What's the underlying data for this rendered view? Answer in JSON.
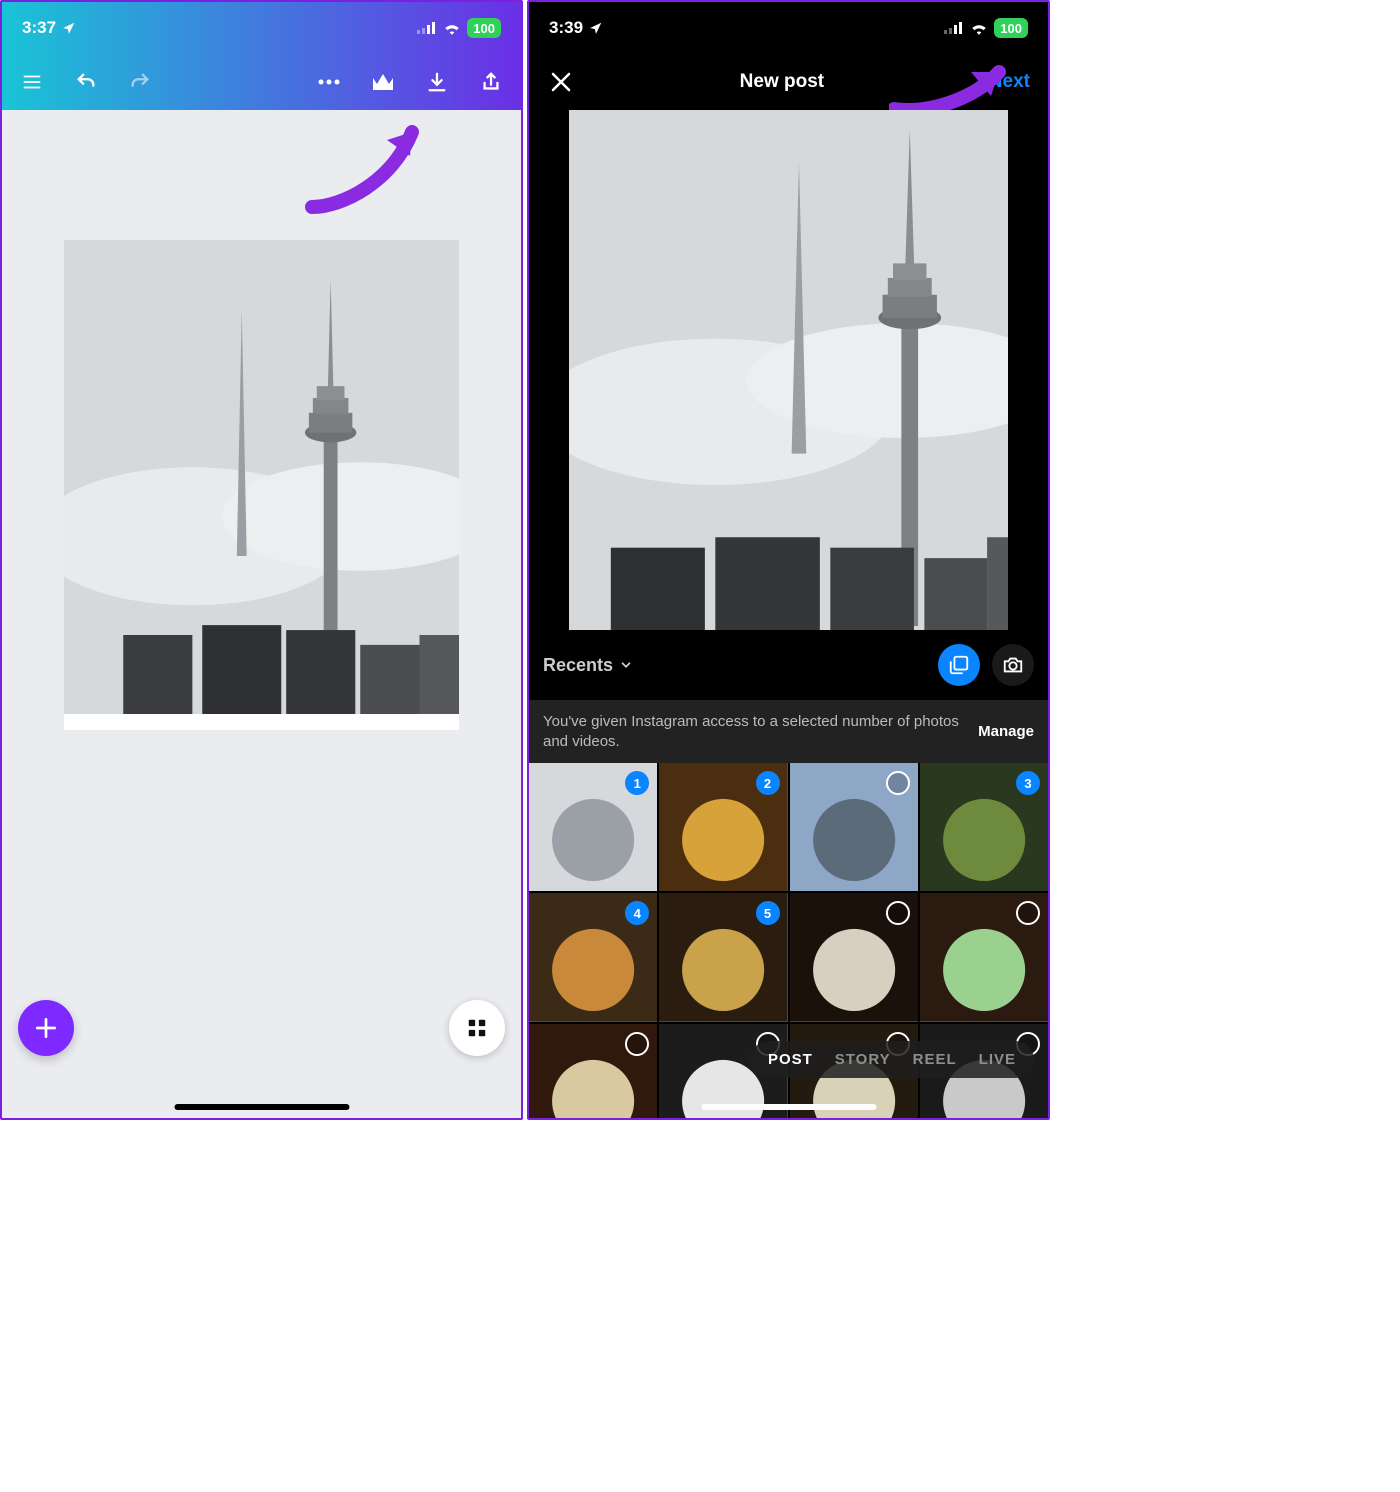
{
  "left": {
    "status": {
      "time": "3:37",
      "battery": "100"
    },
    "toolbar_icons": {
      "menu": "menu-icon",
      "undo": "undo-icon",
      "redo": "redo-icon",
      "more": "more-icon",
      "crown": "crown-icon",
      "download": "download-icon",
      "share": "share-icon"
    }
  },
  "right": {
    "status": {
      "time": "3:39",
      "battery": "100"
    },
    "nav": {
      "title": "New post",
      "next": "Next"
    },
    "album": {
      "label": "Recents"
    },
    "access": {
      "message": "You've given Instagram access to a selected number of photos and videos.",
      "manage": "Manage"
    },
    "thumbs": [
      {
        "selected": true,
        "num": "1"
      },
      {
        "selected": true,
        "num": "2"
      },
      {
        "selected": false
      },
      {
        "selected": true,
        "num": "3"
      },
      {
        "selected": true,
        "num": "4"
      },
      {
        "selected": true,
        "num": "5"
      },
      {
        "selected": false
      },
      {
        "selected": false
      },
      {
        "selected": false
      },
      {
        "selected": false
      },
      {
        "selected": false
      },
      {
        "selected": false
      }
    ],
    "modes": [
      "POST",
      "STORY",
      "REEL",
      "LIVE"
    ],
    "active_mode": "POST"
  },
  "colors": {
    "accent_purple": "#7d29ff",
    "ig_blue": "#0a84ff",
    "battery_green": "#30d158"
  }
}
